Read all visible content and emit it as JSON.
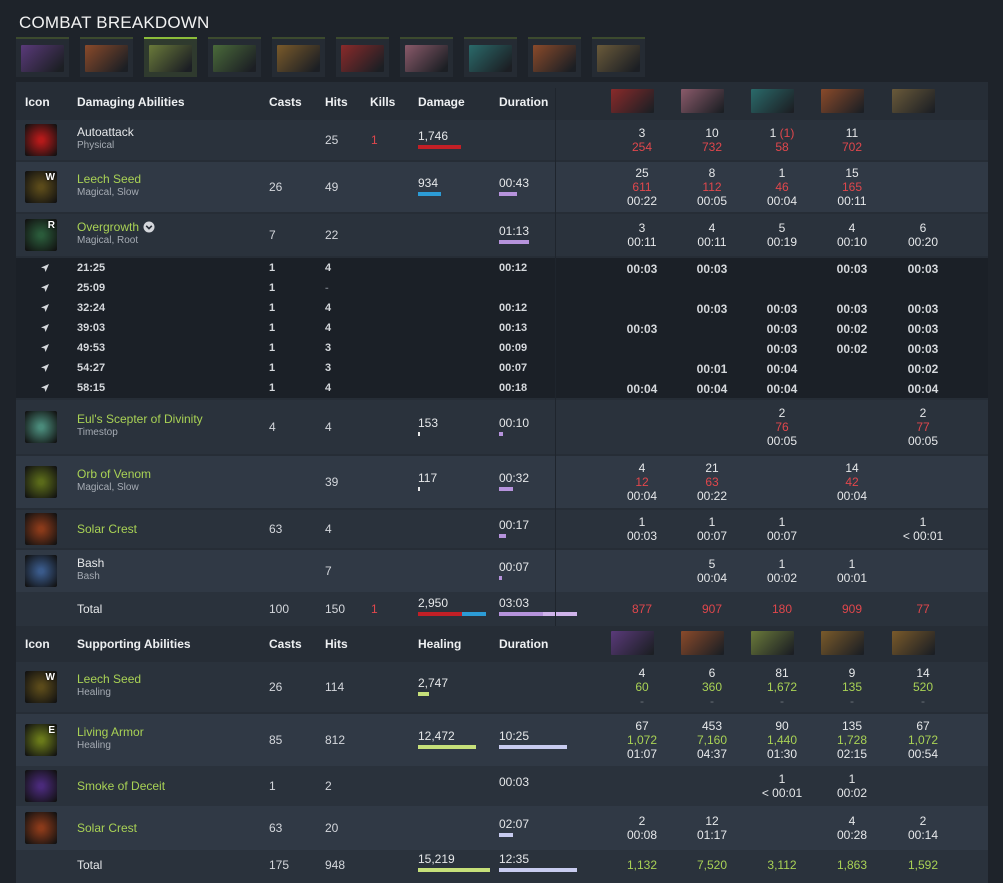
{
  "title": "COMBAT BREAKDOWN",
  "tabs": [
    {
      "hero": "Spectre",
      "color": "#5a3a7a"
    },
    {
      "hero": "Bristleback",
      "color": "#8a4a2a"
    },
    {
      "hero": "Treant Protector",
      "color": "#6a7a3a",
      "active": true
    },
    {
      "hero": "Bristleback variant",
      "color": "#4a6a3a"
    },
    {
      "hero": "Techies",
      "color": "#7a5a2a"
    },
    {
      "hero": "Bloodseeker",
      "color": "#8a2a2a"
    },
    {
      "hero": "Alchemist",
      "color": "#8a5a6a"
    },
    {
      "hero": "Outworld",
      "color": "#2a6a6a"
    },
    {
      "hero": "Ember Spirit",
      "color": "#8a4a2a"
    },
    {
      "hero": "Windranger",
      "color": "#6a5a3a"
    }
  ],
  "damaging": {
    "headers": {
      "icon": "Icon",
      "ability": "Damaging Abilities",
      "casts": "Casts",
      "hits": "Hits",
      "kills": "Kills",
      "damage": "Damage",
      "duration": "Duration"
    },
    "heroes": [
      {
        "color": "#8a2a2a"
      },
      {
        "color": "#8a5a6a"
      },
      {
        "color": "#2a6a6a"
      },
      {
        "color": "#8a4a2a"
      },
      {
        "color": "#6a5a3a"
      }
    ],
    "rows": [
      {
        "name": "Autoattack",
        "type": "Physical",
        "nameColor": "white",
        "casts": "",
        "hits": "25",
        "kills": "1",
        "damage": "1,746",
        "damageFrac": 0.6,
        "duration": "",
        "durFrac": 0,
        "cells": [
          [
            "3",
            "254",
            ""
          ],
          [
            "10",
            "732",
            ""
          ],
          [
            "1 (1)",
            "58",
            ""
          ],
          [
            "11",
            "702",
            ""
          ],
          [
            "",
            "",
            ""
          ]
        ],
        "icon": "#b51a1a",
        "key": ""
      },
      {
        "name": "Leech Seed",
        "type": "Magical, Slow",
        "nameColor": "green",
        "casts": "26",
        "hits": "49",
        "kills": "",
        "damage": "934",
        "damageFrac": 0.32,
        "duration": "00:43",
        "durFrac": 0.23,
        "cells": [
          [
            "25",
            "611",
            "00:22"
          ],
          [
            "8",
            "112",
            "00:05"
          ],
          [
            "1",
            "46",
            "00:04"
          ],
          [
            "15",
            "165",
            "00:11"
          ],
          [
            "",
            "",
            ""
          ]
        ],
        "icon": "#5a4a1a",
        "key": "W"
      },
      {
        "name": "Overgrowth",
        "type": "Magical, Root",
        "nameColor": "green",
        "casts": "7",
        "hits": "22",
        "kills": "",
        "damage": "",
        "damageFrac": 0,
        "duration": "01:13",
        "durFrac": 0.38,
        "cells": [
          [
            "3",
            "",
            "00:11"
          ],
          [
            "4",
            "",
            "00:11"
          ],
          [
            "5",
            "",
            "00:19"
          ],
          [
            "4",
            "",
            "00:10"
          ],
          [
            "6",
            "",
            "00:20"
          ]
        ],
        "icon": "#2a5a3a",
        "key": "R"
      }
    ],
    "sub": [
      {
        "time": "21:25",
        "casts": "1",
        "hits": "4",
        "dur": "00:12",
        "cells": [
          "00:03",
          "00:03",
          "",
          "00:03",
          "00:03"
        ]
      },
      {
        "time": "25:09",
        "casts": "1",
        "hits": "-",
        "dur": "",
        "cells": [
          "",
          "",
          "",
          "",
          ""
        ]
      },
      {
        "time": "32:24",
        "casts": "1",
        "hits": "4",
        "dur": "00:12",
        "cells": [
          "",
          "00:03",
          "00:03",
          "00:03",
          "00:03"
        ]
      },
      {
        "time": "39:03",
        "casts": "1",
        "hits": "4",
        "dur": "00:13",
        "cells": [
          "00:03",
          "",
          "00:03",
          "00:02",
          "00:03"
        ]
      },
      {
        "time": "49:53",
        "casts": "1",
        "hits": "3",
        "dur": "00:09",
        "cells": [
          "",
          "",
          "00:03",
          "00:02",
          "00:03"
        ]
      },
      {
        "time": "54:27",
        "casts": "1",
        "hits": "3",
        "dur": "00:07",
        "cells": [
          "",
          "00:01",
          "00:04",
          "",
          "00:02"
        ]
      },
      {
        "time": "58:15",
        "casts": "1",
        "hits": "4",
        "dur": "00:18",
        "cells": [
          "00:04",
          "00:04",
          "00:04",
          "",
          "00:04"
        ]
      }
    ],
    "rows2": [
      {
        "name": "Eul's Scepter of Divinity",
        "type": "Timestop",
        "nameColor": "green",
        "casts": "4",
        "hits": "4",
        "damage": "153",
        "damageFrac": 0.03,
        "duration": "00:10",
        "durFrac": 0.05,
        "cells": [
          [
            "",
            "",
            ""
          ],
          [
            "",
            "",
            ""
          ],
          [
            "2",
            "76",
            "00:05"
          ],
          [
            "",
            "",
            ""
          ],
          [
            "2",
            "77",
            "00:05"
          ]
        ],
        "icon": "#4a8a7a"
      },
      {
        "name": "Orb of Venom",
        "type": "Magical, Slow",
        "nameColor": "green",
        "casts": "",
        "hits": "39",
        "damage": "117",
        "damageFrac": 0.02,
        "duration": "00:32",
        "durFrac": 0.17,
        "cells": [
          [
            "4",
            "12",
            "00:04"
          ],
          [
            "21",
            "63",
            "00:22"
          ],
          [
            "",
            "",
            ""
          ],
          [
            "14",
            "42",
            "00:04"
          ],
          [
            "",
            "",
            ""
          ]
        ],
        "icon": "#5a6a1a"
      },
      {
        "name": "Solar Crest",
        "type": "",
        "nameColor": "green",
        "casts": "63",
        "hits": "4",
        "damage": "",
        "damageFrac": 0,
        "duration": "00:17",
        "durFrac": 0.09,
        "cells": [
          [
            "1",
            "",
            "00:03"
          ],
          [
            "1",
            "",
            "00:07"
          ],
          [
            "1",
            "",
            "00:07"
          ],
          [
            "",
            "",
            ""
          ],
          [
            "1",
            "",
            "< 00:01"
          ]
        ],
        "icon": "#8a3a1a"
      },
      {
        "name": "Bash",
        "type": "Bash",
        "nameColor": "white",
        "casts": "",
        "hits": "7",
        "damage": "",
        "damageFrac": 0,
        "duration": "00:07",
        "durFrac": 0.04,
        "cells": [
          [
            "",
            "",
            ""
          ],
          [
            "5",
            "",
            "00:04"
          ],
          [
            "1",
            "",
            "00:02"
          ],
          [
            "1",
            "",
            "00:01"
          ],
          [
            "",
            "",
            ""
          ]
        ],
        "icon": "#3a5a8a"
      }
    ],
    "total": {
      "label": "Total",
      "casts": "100",
      "hits": "150",
      "kills": "1",
      "damage": "2,950",
      "duration": "03:03",
      "cells": [
        "877",
        "907",
        "180",
        "909",
        "77"
      ]
    }
  },
  "supporting": {
    "headers": {
      "icon": "Icon",
      "ability": "Supporting Abilities",
      "casts": "Casts",
      "hits": "Hits",
      "healing": "Healing",
      "duration": "Duration"
    },
    "heroes": [
      {
        "color": "#5a3a7a"
      },
      {
        "color": "#8a4a2a"
      },
      {
        "color": "#6a7a3a"
      },
      {
        "color": "#7a5a2a"
      },
      {
        "color": "#7a5a2a"
      }
    ],
    "rows": [
      {
        "name": "Leech Seed",
        "type": "Healing",
        "casts": "26",
        "hits": "114",
        "healing": "2,747",
        "healFrac": 0.15,
        "duration": "",
        "durFrac": 0,
        "cells": [
          [
            "4",
            "60",
            "-"
          ],
          [
            "6",
            "360",
            "-"
          ],
          [
            "81",
            "1,672",
            "-"
          ],
          [
            "9",
            "135",
            "-"
          ],
          [
            "14",
            "520",
            "-"
          ]
        ],
        "icon": "#5a4a1a",
        "key": "W"
      },
      {
        "name": "Living Armor",
        "type": "Healing",
        "casts": "85",
        "hits": "812",
        "healing": "12,472",
        "healFrac": 0.8,
        "duration": "10:25",
        "durFrac": 0.85,
        "cells": [
          [
            "67",
            "1,072",
            "01:07"
          ],
          [
            "453",
            "7,160",
            "04:37"
          ],
          [
            "90",
            "1,440",
            "01:30"
          ],
          [
            "135",
            "1,728",
            "02:15"
          ],
          [
            "67",
            "1,072",
            "00:54"
          ]
        ],
        "icon": "#6a7a1a",
        "key": "E"
      },
      {
        "name": "Smoke of Deceit",
        "type": "",
        "casts": "1",
        "hits": "2",
        "healing": "",
        "healFrac": 0,
        "duration": "00:03",
        "durFrac": 0,
        "cells": [
          [
            "",
            "",
            ""
          ],
          [
            "",
            "",
            ""
          ],
          [
            "1",
            "",
            "< 00:01"
          ],
          [
            "1",
            "",
            "00:02"
          ],
          [
            "",
            "",
            ""
          ]
        ],
        "icon": "#4a2a7a"
      },
      {
        "name": "Solar Crest",
        "type": "",
        "casts": "63",
        "hits": "20",
        "healing": "",
        "healFrac": 0,
        "duration": "02:07",
        "durFrac": 0.17,
        "cells": [
          [
            "2",
            "",
            "00:08"
          ],
          [
            "12",
            "",
            "01:17"
          ],
          [
            "",
            "",
            ""
          ],
          [
            "4",
            "",
            "00:28"
          ],
          [
            "2",
            "",
            "00:14"
          ]
        ],
        "icon": "#8a3a1a"
      }
    ],
    "total": {
      "label": "Total",
      "casts": "175",
      "hits": "948",
      "healing": "15,219",
      "duration": "12:35",
      "cells": [
        "1,132",
        "7,520",
        "3,112",
        "1,863",
        "1,592"
      ]
    }
  }
}
